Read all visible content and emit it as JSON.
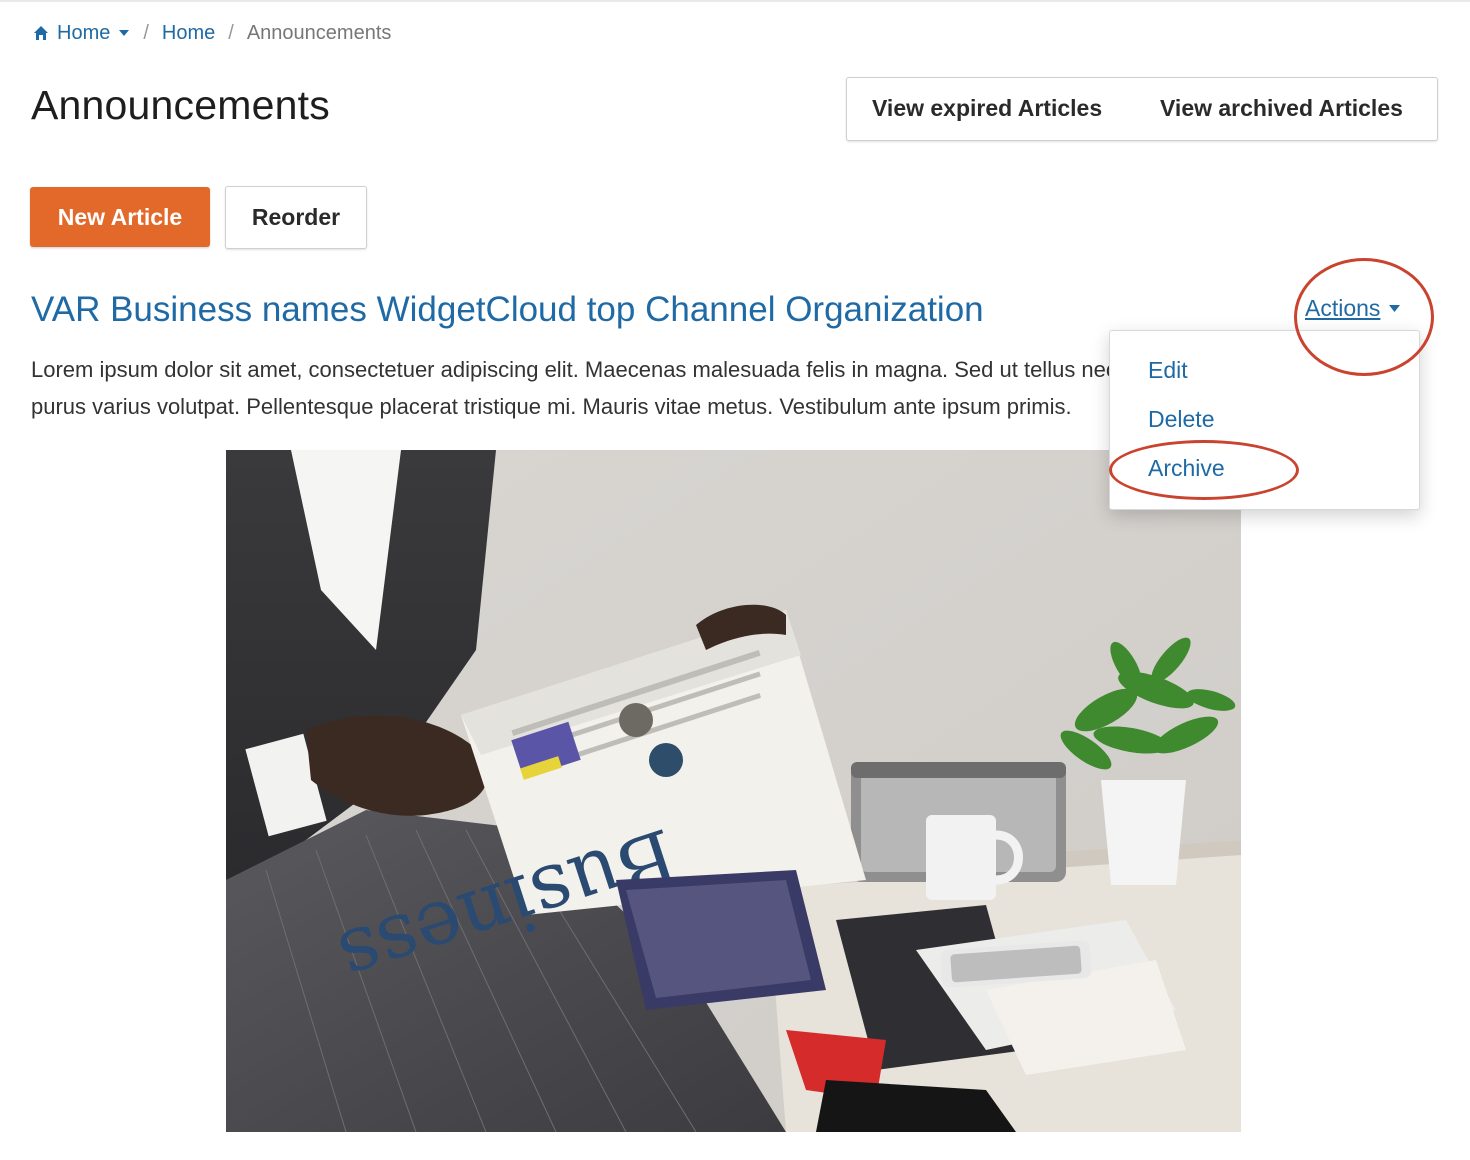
{
  "breadcrumb": {
    "home_dropdown": "Home",
    "home": "Home",
    "current": "Announcements"
  },
  "page": {
    "title": "Announcements"
  },
  "toolbar": {
    "view_expired": "View expired Articles",
    "view_archived": "View archived Articles",
    "new_article": "New Article",
    "reorder": "Reorder"
  },
  "article": {
    "title": "VAR Business names WidgetCloud top Channel Organization",
    "body": "Lorem ipsum dolor sit amet, consectetuer adipiscing elit. Maecenas malesuada felis in magna. Sed ut tellus nec purus varius volutpat. Pellentesque placerat tristique mi. Mauris vitae metus. Vestibulum ante ipsum primis.",
    "image_alt": "Man reading a business newspaper",
    "image_newspaper_text": "Business"
  },
  "actions": {
    "label": "Actions",
    "items": [
      "Edit",
      "Delete",
      "Archive"
    ]
  },
  "colors": {
    "accent": "#e2692a",
    "link": "#1f6aa5",
    "annotation": "#c9432e"
  }
}
